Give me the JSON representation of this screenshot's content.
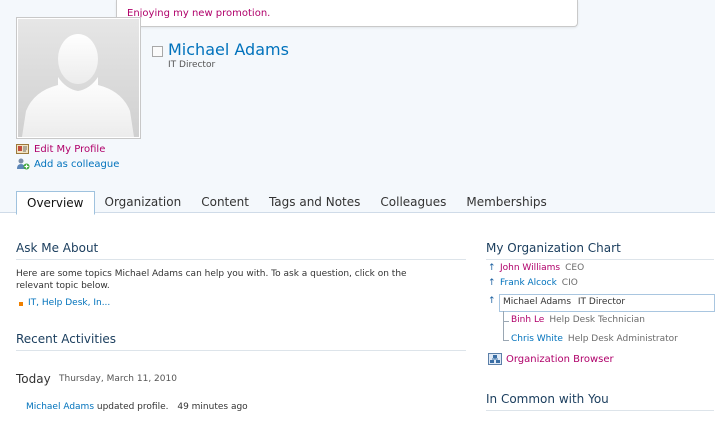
{
  "status": {
    "message": "Enjoying my new promotion."
  },
  "profile": {
    "name": "Michael Adams",
    "title": "IT Director",
    "links": {
      "edit": "Edit My Profile",
      "add_colleague": "Add as colleague"
    }
  },
  "tabs": [
    {
      "label": "Overview",
      "active": true
    },
    {
      "label": "Organization"
    },
    {
      "label": "Content"
    },
    {
      "label": "Tags and Notes"
    },
    {
      "label": "Colleagues"
    },
    {
      "label": "Memberships"
    }
  ],
  "ask_me_about": {
    "heading": "Ask Me About",
    "intro_line1": "Here are some topics Michael Adams can help you with. To ask a question, click on the",
    "intro_line2": "relevant topic below.",
    "topics": "IT, Help Desk, In..."
  },
  "recent_activities": {
    "heading": "Recent Activities",
    "day_label": "Today",
    "date": "Thursday, March 11, 2010",
    "items": [
      {
        "who": "Michael Adams",
        "action": "updated profile.",
        "time": "49 minutes ago"
      }
    ]
  },
  "org_chart": {
    "heading": "My Organization Chart",
    "managers": [
      {
        "name": "John Williams",
        "title": "CEO"
      },
      {
        "name": "Frank Alcock",
        "title": "CIO"
      }
    ],
    "current": {
      "name": "Michael Adams",
      "title": "IT Director"
    },
    "reports": [
      {
        "name": "Binh Le",
        "title": "Help Desk Technician"
      },
      {
        "name": "Chris White",
        "title": "Help Desk Administrator"
      }
    ],
    "browser_link": "Organization Browser"
  },
  "in_common": {
    "heading": "In Common with You"
  },
  "colors": {
    "link_blue": "#0072bc",
    "link_magenta": "#b0006a",
    "bullet_orange": "#f08000"
  }
}
